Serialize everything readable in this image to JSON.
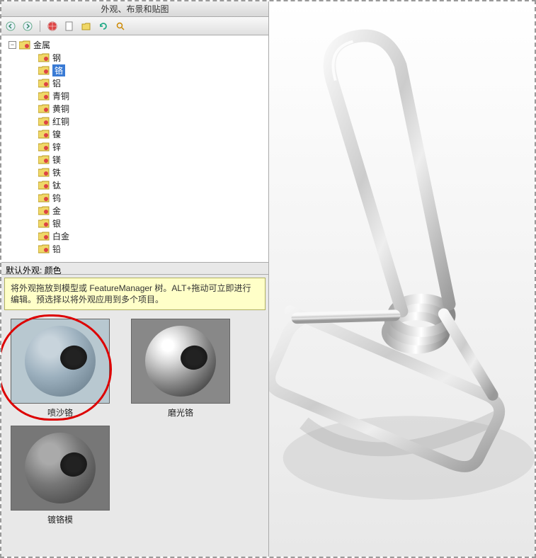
{
  "panel": {
    "title": "外观、布景和贴图"
  },
  "toolbar": {
    "back": "back",
    "forward": "forward",
    "home": "home",
    "globe": "globe",
    "doc": "doc",
    "save": "save",
    "refresh": "refresh",
    "search": "search"
  },
  "tree": {
    "root": {
      "label": "金属"
    },
    "items": [
      {
        "label": "钢",
        "selected": false
      },
      {
        "label": "铬",
        "selected": true
      },
      {
        "label": "铝",
        "selected": false
      },
      {
        "label": "青铜",
        "selected": false
      },
      {
        "label": "黄铜",
        "selected": false
      },
      {
        "label": "红铜",
        "selected": false
      },
      {
        "label": "镍",
        "selected": false
      },
      {
        "label": "锌",
        "selected": false
      },
      {
        "label": "镁",
        "selected": false
      },
      {
        "label": "铁",
        "selected": false
      },
      {
        "label": "钛",
        "selected": false
      },
      {
        "label": "钨",
        "selected": false
      },
      {
        "label": "金",
        "selected": false
      },
      {
        "label": "银",
        "selected": false
      },
      {
        "label": "白金",
        "selected": false
      },
      {
        "label": "铅",
        "selected": false
      }
    ]
  },
  "default_label": "默认外观: 颜色",
  "hint": "将外观拖放到模型或 FeatureManager 树。ALT+拖动可立即进行编辑。预选择以将外观应用到多个项目。",
  "thumbs": [
    {
      "label": "喷沙铬",
      "style": "matte",
      "circled": true
    },
    {
      "label": "磨光铬",
      "style": "polished",
      "circled": false
    },
    {
      "label": "镀铬模",
      "style": "textured",
      "circled": false
    }
  ],
  "colors": {
    "selection": "#3a7bd5",
    "hint_bg": "#ffffc8",
    "annotation": "#d00"
  }
}
